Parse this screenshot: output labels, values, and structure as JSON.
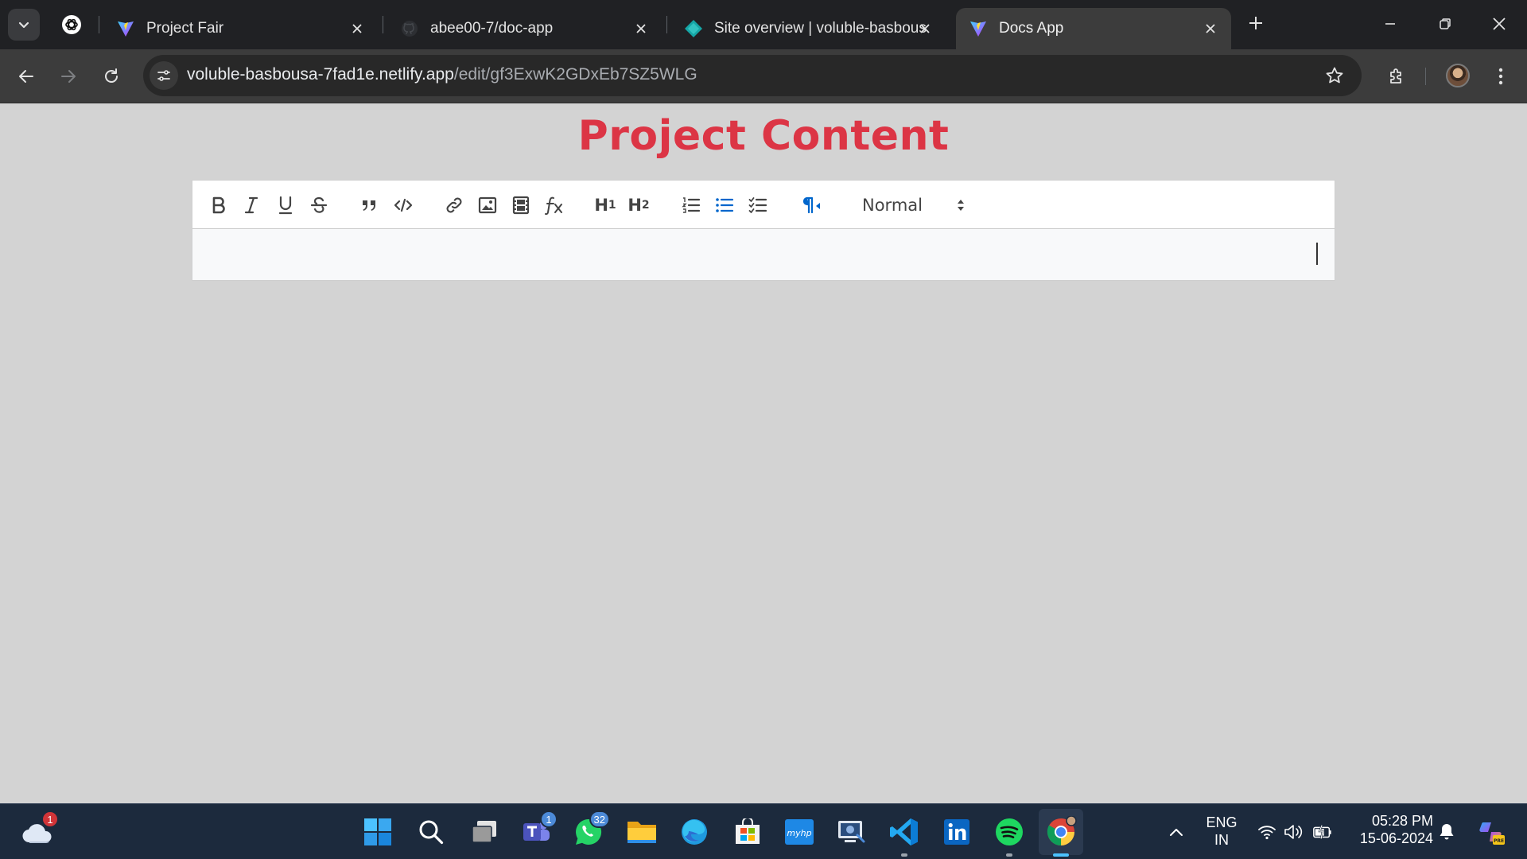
{
  "browser": {
    "tabs": [
      {
        "title": "Project Fair",
        "active": false
      },
      {
        "title": "abee00-7/doc-app",
        "active": false
      },
      {
        "title": "Site overview | voluble-basbous",
        "active": false
      },
      {
        "title": "Docs App",
        "active": true
      }
    ],
    "address": {
      "domain": "voluble-basbousa-7fad1e.netlify.app",
      "path": "/edit/gf3ExwK2GDxEb7SZ5WLG"
    }
  },
  "page": {
    "title": "Project Content",
    "title_color": "#dc3545"
  },
  "editor": {
    "toolbar": {
      "h1_label": "H",
      "h1_sub": "1",
      "h2_label": "H",
      "h2_sub": "2",
      "header_select_value": "Normal"
    },
    "content": ""
  },
  "taskbar": {
    "weather_badge": "1",
    "teams_badge": "1",
    "whatsapp_badge": "32",
    "language": "ENG",
    "region": "IN",
    "time": "05:28 PM",
    "date": "15-06-2024"
  }
}
